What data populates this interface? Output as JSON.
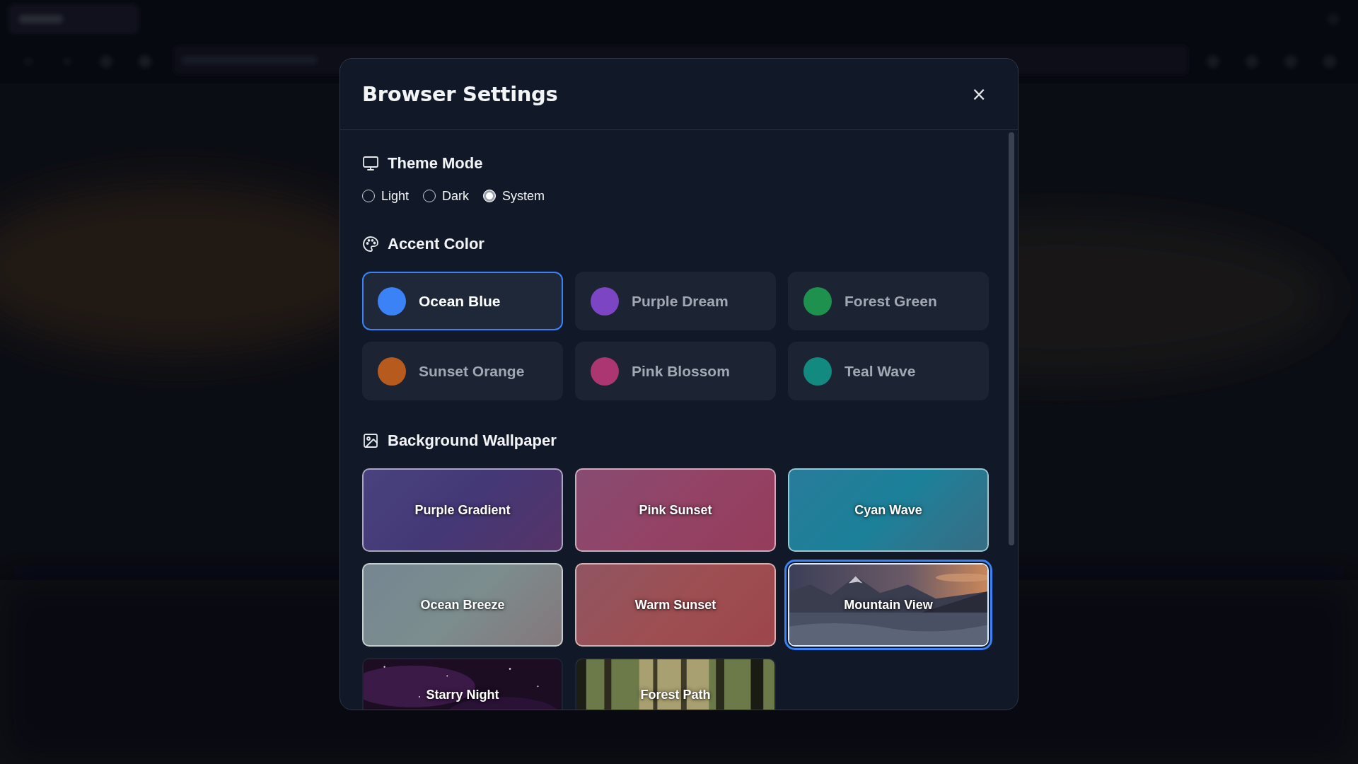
{
  "dialog": {
    "title": "Browser Settings",
    "close": "×",
    "theme_mode": {
      "heading": "Theme Mode",
      "options": [
        {
          "label": "Light",
          "selected": false
        },
        {
          "label": "Dark",
          "selected": false
        },
        {
          "label": "System",
          "selected": true
        }
      ]
    },
    "accent_color": {
      "heading": "Accent Color",
      "options": [
        {
          "label": "Ocean Blue",
          "color": "#3b82f6",
          "selected": true
        },
        {
          "label": "Purple Dream",
          "color": "#7c45c4",
          "selected": false
        },
        {
          "label": "Forest Green",
          "color": "#1f914f",
          "selected": false
        },
        {
          "label": "Sunset Orange",
          "color": "#b75a1d",
          "selected": false
        },
        {
          "label": "Pink Blossom",
          "color": "#ab3671",
          "selected": false
        },
        {
          "label": "Teal Wave",
          "color": "#138a80",
          "selected": false
        }
      ]
    },
    "wallpaper": {
      "heading": "Background Wallpaper",
      "options": [
        {
          "label": "Purple Gradient",
          "kind": "gradient",
          "color": "#443876",
          "selected": false
        },
        {
          "label": "Pink Sunset",
          "kind": "gradient",
          "color": "#934366",
          "selected": false
        },
        {
          "label": "Cyan Wave",
          "kind": "gradient",
          "color": "#1b8099",
          "selected": false
        },
        {
          "label": "Ocean Breeze",
          "kind": "gradient",
          "color": "#7c8d8e",
          "selected": false
        },
        {
          "label": "Warm Sunset",
          "kind": "gradient",
          "color": "#9d4f52",
          "selected": false
        },
        {
          "label": "Mountain View",
          "kind": "picture",
          "selected": true
        },
        {
          "label": "Starry Night",
          "kind": "picture",
          "selected": false
        },
        {
          "label": "Forest Path",
          "kind": "picture",
          "selected": false
        }
      ]
    }
  }
}
